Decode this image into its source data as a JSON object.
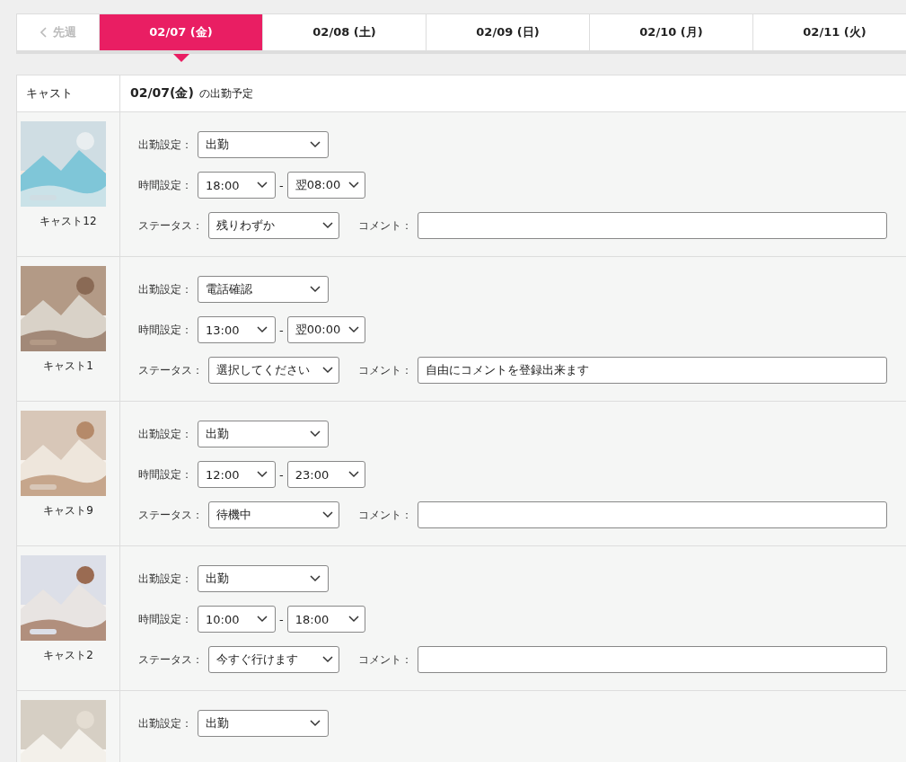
{
  "week_nav": {
    "prev": {
      "label": "先週",
      "disabled": true
    },
    "tabs": [
      {
        "label": "02/07 (金)",
        "selected": true
      },
      {
        "label": "02/08 (土)",
        "selected": false
      },
      {
        "label": "02/09 (日)",
        "selected": false
      },
      {
        "label": "02/10 (月)",
        "selected": false
      },
      {
        "label": "02/11 (火)",
        "selected": false
      }
    ]
  },
  "table": {
    "cast_header": "キャスト",
    "schedule_date": "02/07(金)",
    "schedule_suffix": "の出勤予定",
    "rows": [
      {
        "name": "キャスト12",
        "attendance_label": "出勤設定：",
        "attendance": "出勤",
        "time_label": "時間設定：",
        "start": "18:00",
        "separator": "-",
        "end": "翌08:00",
        "status_label": "ステータス：",
        "status": "残りわずか",
        "comment_label": "コメント：",
        "comment": ""
      },
      {
        "name": "キャスト1",
        "attendance_label": "出勤設定：",
        "attendance": "電話確認",
        "time_label": "時間設定：",
        "start": "13:00",
        "separator": "-",
        "end": "翌00:00",
        "status_label": "ステータス：",
        "status": "選択してください",
        "comment_label": "コメント：",
        "comment": "自由にコメントを登録出来ます"
      },
      {
        "name": "キャスト9",
        "attendance_label": "出勤設定：",
        "attendance": "出勤",
        "time_label": "時間設定：",
        "start": "12:00",
        "separator": "-",
        "end": "23:00",
        "status_label": "ステータス：",
        "status": "待機中",
        "comment_label": "コメント：",
        "comment": ""
      },
      {
        "name": "キャスト2",
        "attendance_label": "出勤設定：",
        "attendance": "出勤",
        "time_label": "時間設定：",
        "start": "10:00",
        "separator": "-",
        "end": "18:00",
        "status_label": "ステータス：",
        "status": "今すぐ行けます",
        "comment_label": "コメント：",
        "comment": ""
      },
      {
        "attendance_label": "出勤設定：",
        "attendance": "出勤"
      }
    ]
  }
}
